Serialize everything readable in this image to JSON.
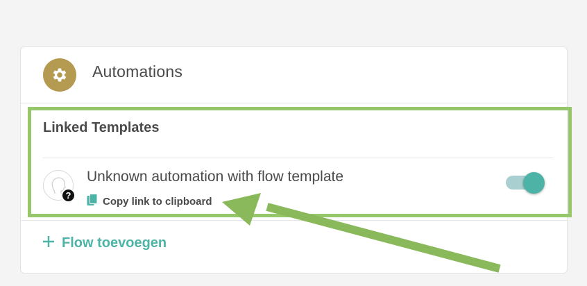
{
  "card": {
    "title": "Automations",
    "icon": "gear-icon",
    "icon_color": "#b59a52"
  },
  "linked_templates": {
    "title": "Linked Templates",
    "items": [
      {
        "avatar_icon": "user-outline-icon",
        "badge_icon": "question-badge-icon",
        "badge_text": "?",
        "title": "Unknown automation with flow template",
        "copy_link_label": "Copy link to clipboard",
        "copy_icon": "clipboard-icon",
        "enabled": true
      }
    ]
  },
  "footer": {
    "add_flow_label": "Flow toevoegen",
    "add_icon": "plus-icon"
  },
  "colors": {
    "accent": "#4db3a7",
    "gear": "#b59a52",
    "annotation_green": "#8ab95c"
  }
}
